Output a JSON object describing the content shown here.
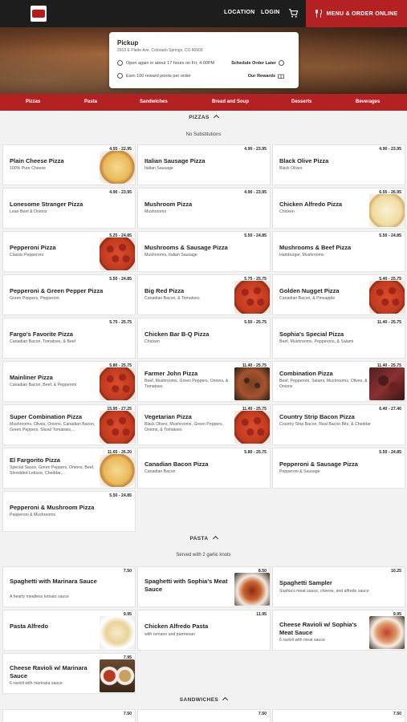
{
  "header": {
    "logo_text": "Old Chicago",
    "location_label": "LOCATION",
    "login_label": "LOGIN",
    "cart_icon": "cart-icon",
    "order_label": "MENU & ORDER ONLINE"
  },
  "pickup": {
    "title": "Pickup",
    "address": "2910 E Platte Ave, Colorado Springs, CO 80909",
    "open_text": "Open again in about 17 hours on Fri, 4:00PM",
    "schedule_label": "Schedule Order Later",
    "points_text": "Earn 100 reward points per order",
    "rewards_label": "Our Rewards"
  },
  "categories": [
    "Pizzas",
    "Pasta",
    "Sandwiches",
    "Bread and Soup",
    "Desserts",
    "Beverages"
  ],
  "sections": {
    "pizzas": {
      "title": "PIZZAS",
      "subtitle": "No Substitutions"
    },
    "pasta": {
      "title": "PASTA",
      "subtitle": "Served with 2 garlic knots"
    },
    "sandwiches": {
      "title": "SANDWICHES"
    }
  },
  "pizzas": [
    {
      "name": "Plain Cheese Pizza",
      "desc": "100% Pure Cheese",
      "price": "4.55 - 22.95",
      "img": "cheese"
    },
    {
      "name": "Italian Sausage Pizza",
      "desc": "Italian Sausage",
      "price": "4.90 - 23.95"
    },
    {
      "name": "Black Olive Pizza",
      "desc": "Black Olives",
      "price": "4.90 - 23.95"
    },
    {
      "name": "Lonesome Stranger Pizza",
      "desc": "Lean Beef & Onions",
      "price": "4.90 - 23.95"
    },
    {
      "name": "Mushroom Pizza",
      "desc": "Mushrooms",
      "price": "4.90 - 23.95"
    },
    {
      "name": "Chicken Alfredo Pizza",
      "desc": "Chicken",
      "price": "6.55 - 26.95",
      "img": "alfredo"
    },
    {
      "name": "Pepperoni Pizza",
      "desc": "Classic Pepperoni",
      "price": "5.25 - 24.85",
      "img": "pep"
    },
    {
      "name": "Mushrooms & Sausage Pizza",
      "desc": "Mushrooms, Italian Sausage",
      "price": "5.50 - 24.85"
    },
    {
      "name": "Mushrooms & Beef Pizza",
      "desc": "Hamburger, Mushrooms",
      "price": "5.50 - 24.85"
    },
    {
      "name": "Pepperoni & Green Pepper Pizza",
      "desc": "Green Peppers, Pepperoni",
      "price": "5.50 - 24.85"
    },
    {
      "name": "Big Red Pizza",
      "desc": "Canadian Bacon, & Tomatoes",
      "price": "5.75 - 25.75",
      "img": "pep"
    },
    {
      "name": "Golden Nugget Pizza",
      "desc": "Canadian Bacon, & Pineapple",
      "price": "5.40 - 25.75",
      "img": "pep"
    },
    {
      "name": "Fargo's Favorite Pizza",
      "desc": "Canadian Bacon, Tomatoes, & Beef",
      "price": "5.75 - 25.75"
    },
    {
      "name": "Chicken Bar B-Q Pizza",
      "desc": "Chicken",
      "price": "5.50 - 25.75"
    },
    {
      "name": "Sophia's Special Pizza",
      "desc": "Beef, Mushrooms, Pepperons, & Salami",
      "price": "11.40 - 25.75"
    },
    {
      "name": "Mainliner Pizza",
      "desc": "Canadian Bacon, Beef, & Pepperoni",
      "price": "5.80 - 25.75",
      "img": "pep"
    },
    {
      "name": "Farmer John Pizza",
      "desc": "Beef, Mushrooms, Green Peppers, Onions, & Tomatoes",
      "price": "11.40 - 25.75",
      "img": "sup"
    },
    {
      "name": "Combination Pizza",
      "desc": "Beef, Pepperoni, Salami, Mushrooms, Olives, & Onions",
      "price": "11.40 - 25.75",
      "img": "dark"
    },
    {
      "name": "Super Combination Pizza",
      "desc": "Mushrooms, Olives, Onions, Canadian Bacon, Green Peppers, Sliced Tomatoes,...",
      "price": "15.95 - 27.25",
      "img": "pep"
    },
    {
      "name": "Vegetarian Pizza",
      "desc": "Black Olives, Mushrooms, Green Peppers, Onions, & Tomatoes",
      "price": "11.40 - 25.75",
      "img": "pep"
    },
    {
      "name": "Country Strip Bacon Pizza",
      "desc": "Country Strip Bacon, Real Bacon Bits, & Cheddar",
      "price": "6.40 - 27.40"
    },
    {
      "name": "El Fargorito Pizza",
      "desc": "Special Sauce, Green Peppers, Onions, Beef, Shredded Lettuce, Cheddar,...",
      "price": "11.65 - 26.20",
      "img": "cheese"
    },
    {
      "name": "Canadian Bacon Pizza",
      "desc": "Canadian Bacon",
      "price": "5.80 - 25.75"
    },
    {
      "name": "Pepperoni & Sausage Pizza",
      "desc": "Pepperoni & Sausage",
      "price": "5.50 - 24.85"
    },
    {
      "name": "Pepperoni & Mushroom Pizza",
      "desc": "Pepperoni & Mushrooms",
      "price": "5.50 - 24.85"
    }
  ],
  "pasta": [
    {
      "name": "Spaghetti with Marinara Sauce",
      "desc": "A hearty meatless tomato sauce",
      "price": "7.50"
    },
    {
      "name": "Spaghetti with Sophia's Meat Sauce",
      "desc": "",
      "price": "8.50",
      "img": "pasta"
    },
    {
      "name": "Spaghetti Sampler",
      "desc": "Sophia's meat sauce, cheese, and alfredo sauce",
      "price": "10.25"
    },
    {
      "name": "Pasta Alfredo",
      "desc": "",
      "price": "9.95",
      "img": "alfpasta"
    },
    {
      "name": "Chicken Alfredo Pasta",
      "desc": "with romano and parmesan",
      "price": "11.95"
    },
    {
      "name": "Cheese Ravioli w/ Sophia's Meat Sauce",
      "desc": "6 ravioli with meat sauce",
      "price": "9.95",
      "img": "ravioli"
    },
    {
      "name": "Cheese Ravioli w/ Marinara Sauce",
      "desc": "6 ravioli with marinara sauce",
      "price": "7.95",
      "img": "bowls"
    }
  ],
  "sandwiches": [
    {
      "price": "7.50"
    },
    {
      "price": "7.50"
    },
    {
      "price": "7.50"
    }
  ]
}
